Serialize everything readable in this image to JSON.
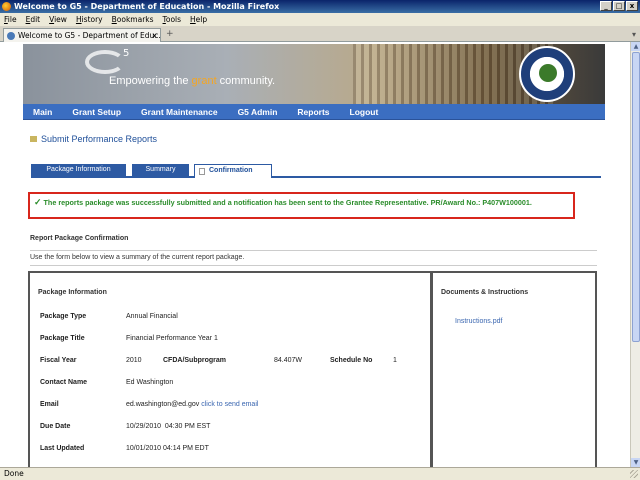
{
  "window": {
    "title": "Welcome to G5 - Department of Education - Mozilla Firefox",
    "minimize": "_",
    "maximize": "□",
    "close": "x"
  },
  "menubar": [
    "File",
    "Edit",
    "View",
    "History",
    "Bookmarks",
    "Tools",
    "Help"
  ],
  "browser_tab": {
    "label": "Welcome to G5 - Department of Educ...",
    "close": "x",
    "new_tab": "+",
    "list_tabs": "▾"
  },
  "banner": {
    "logo_sup": "5",
    "tagline_pre": "Empowering the ",
    "tagline_accent": "grant",
    "tagline_post": " community.",
    "accent_color": "#f5a623"
  },
  "nav": [
    "Main",
    "Grant Setup",
    "Grant Maintenance",
    "G5 Admin",
    "Reports",
    "Logout"
  ],
  "page": {
    "heading": "Submit Performance Reports",
    "subtabs": [
      "Package Information",
      "Summary",
      "Confirmation"
    ],
    "active_subtab": "Confirmation",
    "success_message": "The reports package was successfully submitted and a notification has been sent to the Grantee Representative. PR/Award No.: P407W100001.",
    "success_check": "✓",
    "section_title": "Report Package Confirmation",
    "instructions": "Use the form below to view a summary of the current report package."
  },
  "package_info": {
    "title": "Package Information",
    "package_type_label": "Package Type",
    "package_type": "Annual Financial",
    "package_title_label": "Package Title",
    "package_title": "Financial Performance Year 1",
    "fiscal_year_label": "Fiscal Year",
    "fiscal_year": "2010",
    "cfda_label": "CFDA/Subprogram",
    "cfda": "84.407W",
    "schedule_label": "Schedule No",
    "schedule": "1",
    "contact_label": "Contact Name",
    "contact": "Ed Washington",
    "email_label": "Email",
    "email": "ed.washington@ed.gov",
    "email_link": "click to send email",
    "due_label": "Due Date",
    "due": "10/29/2010  04:30 PM EST",
    "updated_label": "Last Updated",
    "updated": "10/01/2010 04:14 PM EDT"
  },
  "docs": {
    "title": "Documents & Instructions",
    "link": "Instructions.pdf"
  },
  "statusbar": {
    "text": "Done"
  },
  "colors": {
    "nav_blue": "#3b6ec1",
    "success_green": "#2a8c2a",
    "alert_red": "#d8261c",
    "link_blue": "#3a66b0"
  }
}
